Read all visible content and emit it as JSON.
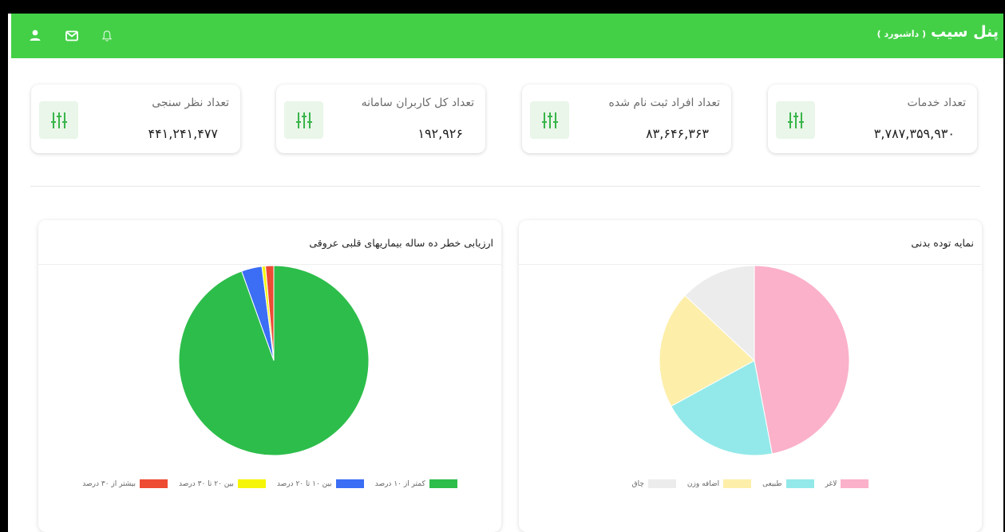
{
  "header": {
    "brand": "پنل سیب",
    "brand_sub": "( داشبورد )",
    "colors": {
      "bar": "#43d047"
    },
    "icons": [
      "user-icon",
      "mail-icon",
      "bell-icon"
    ]
  },
  "stats": [
    {
      "title": "تعداد خدمات",
      "value": "۳,۷۸۷,۳۵۹,۹۳۰",
      "icon": "sliders-icon"
    },
    {
      "title": "تعداد افراد ثبت نام شده",
      "value": "۸۳,۶۴۶,۳۶۳",
      "icon": "sliders-icon"
    },
    {
      "title": "تعداد کل کاربران سامانه",
      "value": "۱۹۲,۹۲۶",
      "icon": "sliders-icon"
    },
    {
      "title": "تعداد نظر سنجی",
      "value": "۴۴۱,۲۴۱,۴۷۷",
      "icon": "sliders-icon"
    }
  ],
  "panels": {
    "bmi": {
      "title": "نمایه توده بدنی"
    },
    "risk": {
      "title": "ارزیابی خطر ده ساله بیماریهای قلبی عروقی"
    }
  },
  "chart_data": [
    {
      "type": "pie",
      "title": "نمایه توده بدنی",
      "categories": [
        "لاغر",
        "طبیعی",
        "اضافه وزن",
        "چاق"
      ],
      "values": [
        47,
        20,
        20,
        13
      ],
      "colors": [
        "#fbb1c9",
        "#93e9e9",
        "#fdeeaa",
        "#ececec"
      ],
      "legend": "bottom"
    },
    {
      "type": "pie",
      "title": "ارزیابی خطر ده ساله بیماریهای قلبی عروقی",
      "categories": [
        "کمتر از ۱۰ درصد",
        "بین ۱۰ تا ۲۰ درصد",
        "بین ۲۰ تا ۳۰ درصد",
        "بیشتر از ۳۰ درصد"
      ],
      "values": [
        94.5,
        3.5,
        0.6,
        1.4
      ],
      "colors": [
        "#2dbd4b",
        "#3b6ef5",
        "#f5f50a",
        "#ee4b33"
      ],
      "legend": "bottom"
    }
  ]
}
